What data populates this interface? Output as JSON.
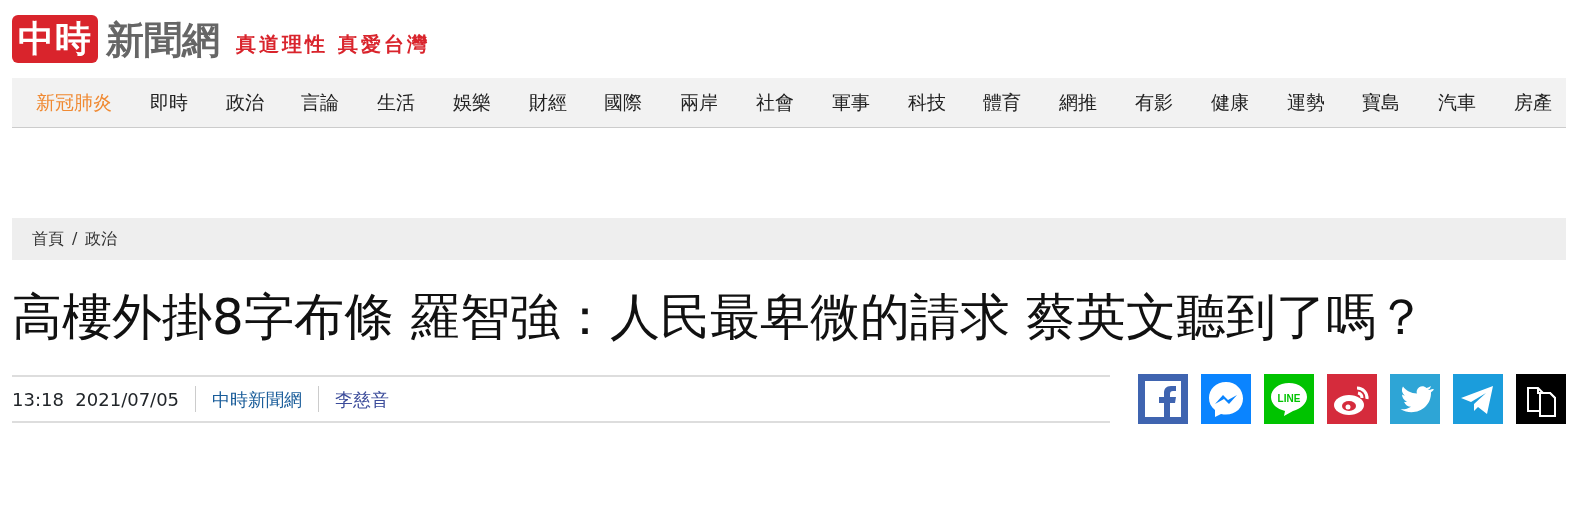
{
  "logo": {
    "mark": "中時",
    "name": "新聞網",
    "slogan": "真道理性 真愛台灣"
  },
  "nav": [
    {
      "label": "新冠肺炎",
      "selected": true
    },
    {
      "label": "即時",
      "selected": false
    },
    {
      "label": "政治",
      "selected": false
    },
    {
      "label": "言論",
      "selected": false
    },
    {
      "label": "生活",
      "selected": false
    },
    {
      "label": "娛樂",
      "selected": false
    },
    {
      "label": "財經",
      "selected": false
    },
    {
      "label": "國際",
      "selected": false
    },
    {
      "label": "兩岸",
      "selected": false
    },
    {
      "label": "社會",
      "selected": false
    },
    {
      "label": "軍事",
      "selected": false
    },
    {
      "label": "科技",
      "selected": false
    },
    {
      "label": "體育",
      "selected": false
    },
    {
      "label": "網推",
      "selected": false
    },
    {
      "label": "有影",
      "selected": false
    },
    {
      "label": "健康",
      "selected": false
    },
    {
      "label": "運勢",
      "selected": false
    },
    {
      "label": "寶島",
      "selected": false
    },
    {
      "label": "汽車",
      "selected": false
    },
    {
      "label": "房產",
      "selected": false
    }
  ],
  "breadcrumb": [
    "首頁",
    "政治"
  ],
  "breadcrumb_separator": "/",
  "headline": "高樓外掛8字布條 羅智強：人民最卑微的請求 蔡英文聽到了嗎？",
  "meta": {
    "time": "13:18",
    "date": "2021/07/05",
    "source": "中時新聞網",
    "author": "李慈音"
  },
  "share": [
    {
      "kind": "facebook"
    },
    {
      "kind": "messenger"
    },
    {
      "kind": "line",
      "label": "LINE"
    },
    {
      "kind": "weibo"
    },
    {
      "kind": "twitter"
    },
    {
      "kind": "telegram"
    },
    {
      "kind": "copy"
    }
  ]
}
